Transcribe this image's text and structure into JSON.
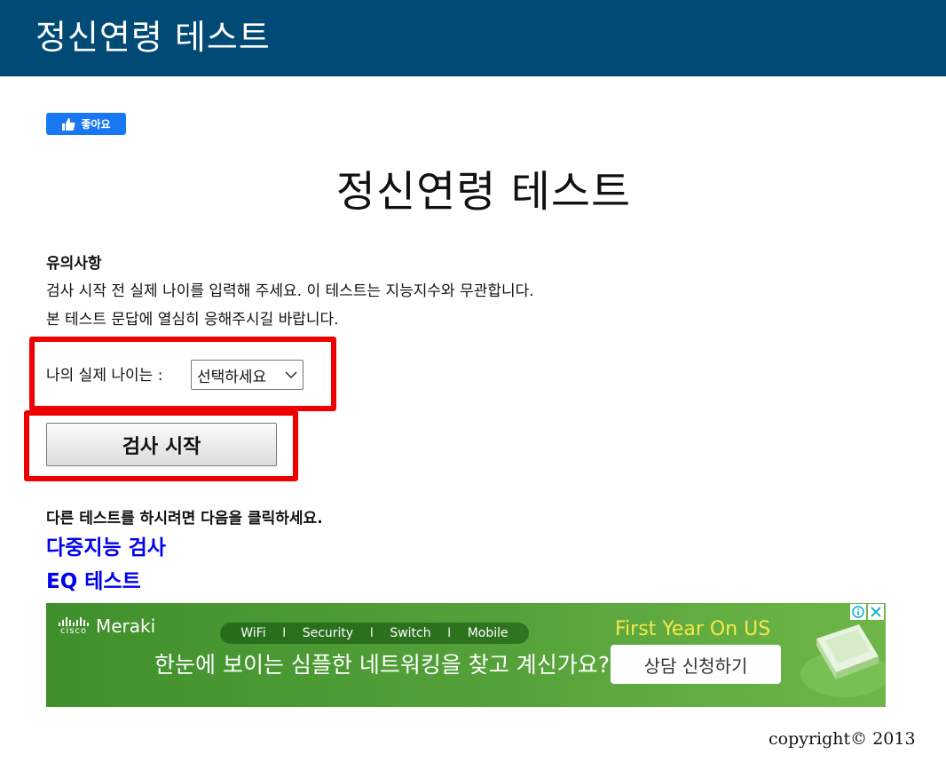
{
  "header": {
    "title": "정신연령 테스트"
  },
  "facebook": {
    "like_label": "좋아요"
  },
  "main": {
    "title": "정신연령 테스트",
    "notice_heading": "유의사항",
    "notice_lines": [
      "검사 시작 전 실제 나이를 입력해 주세요. 이 테스트는 지능지수와 무관합니다.",
      "본 테스트 문답에 열심히 응해주시길 바랍니다."
    ],
    "age_label": "나의 실제 나이는 :",
    "age_select_value": "선택하세요",
    "start_button": "검사 시작",
    "other_tests_heading": "다른 테스트를 하시려면 다음을 클릭하세요.",
    "links": [
      "다중지능 검사",
      "EQ 테스트"
    ]
  },
  "ad": {
    "brand_small": "cisco",
    "brand": "Meraki",
    "pills": [
      "WiFi",
      "Security",
      "Switch",
      "Mobile"
    ],
    "pill_separator": "I",
    "headline": "한눈에 보이는 심플한 네트워킹을 찾고 계신가요?",
    "offer": "First Year On US",
    "cta": "상담 신청하기",
    "accent_color": "#f5e84a"
  },
  "footer": {
    "copyright": "copyright© 2013"
  },
  "colors": {
    "header_bg": "#024a76",
    "highlight": "#ee0000",
    "link": "#0000ee",
    "fb_blue": "#1877f2"
  }
}
